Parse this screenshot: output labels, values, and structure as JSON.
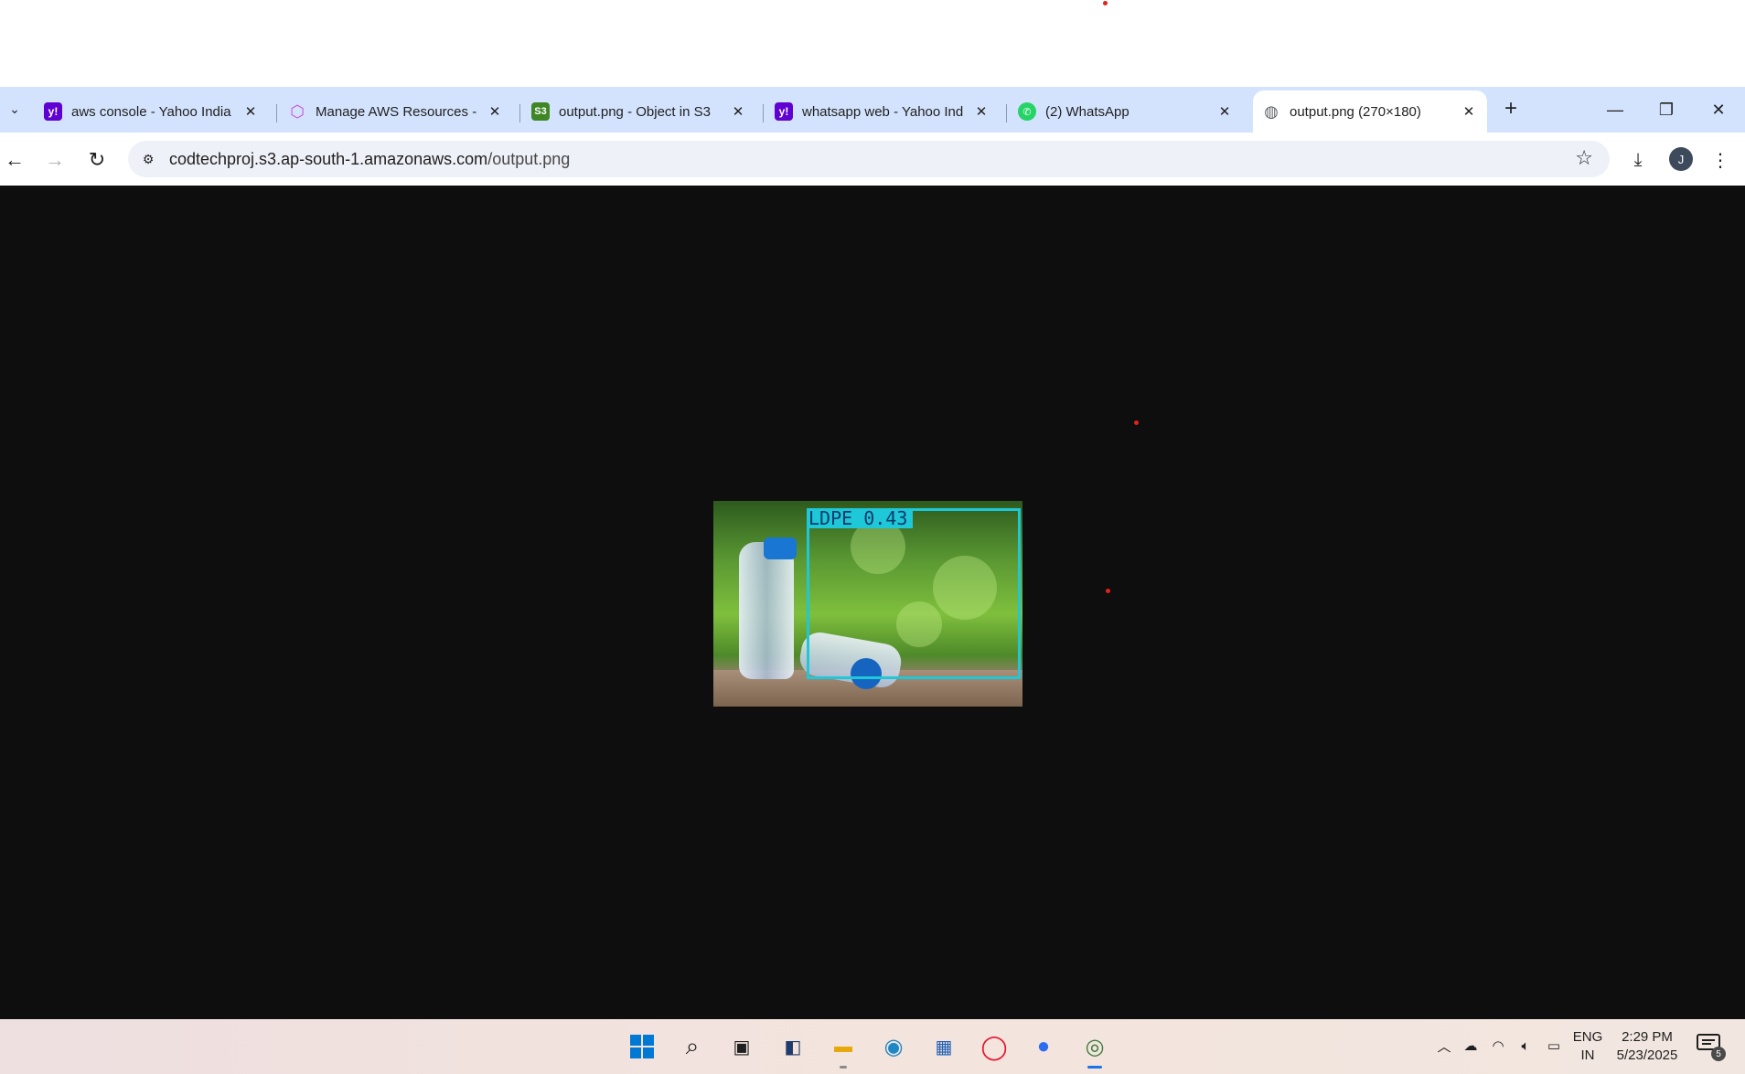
{
  "browser": {
    "tabs": [
      {
        "title": "aws console - Yahoo India",
        "favicon": "yahoo-icon",
        "color": "#6001d2"
      },
      {
        "title": "Manage AWS Resources -",
        "favicon": "aws-cube-icon",
        "color": "#c94fd6"
      },
      {
        "title": "output.png - Object in S3",
        "favicon": "s3-icon",
        "color": "#3f8624"
      },
      {
        "title": "whatsapp web - Yahoo Ind",
        "favicon": "yahoo-icon",
        "color": "#6001d2"
      },
      {
        "title": "(2) WhatsApp",
        "favicon": "whatsapp-icon",
        "color": "#25d366"
      },
      {
        "title": "output.png (270×180)",
        "favicon": "globe-icon",
        "color": "#5f6368"
      }
    ],
    "url_host": "codtechproj.s3.ap-south-1.amazonaws.com",
    "url_path": "/output.png",
    "profile_initial": "J"
  },
  "image": {
    "detection_label": "LDPE 0.43",
    "box_color": "#1ec8d8"
  },
  "taskbar": {
    "apps": [
      "windows-start-icon",
      "search-icon",
      "task-view-icon",
      "widgets-icon",
      "file-explorer-icon",
      "edge-icon",
      "store-icon",
      "opera-icon",
      "zoom-icon",
      "chrome-icon"
    ],
    "language_top": "ENG",
    "language_bottom": "IN",
    "time": "2:29 PM",
    "date": "5/23/2025",
    "notification_count": "5"
  }
}
